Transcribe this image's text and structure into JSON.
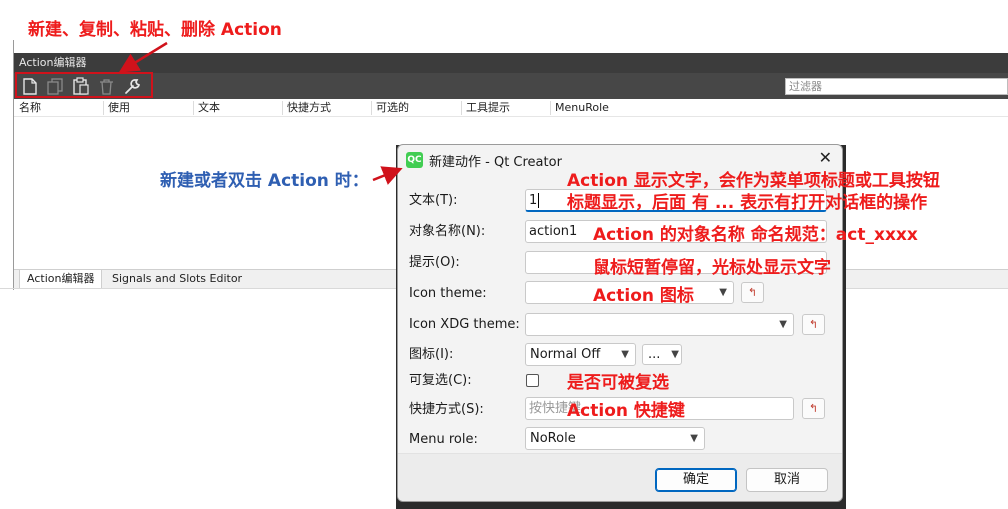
{
  "annotations": {
    "toolbar_note": "新建、复制、粘贴、删除 Action",
    "new_action_note": "新建或者双击 Action 时：",
    "text_note_line1": "Action 显示文字，会作为菜单项标题或工具按钮",
    "text_note_line2": "标题显示，后面 有 ... 表示有打开对话框的操作",
    "object_name_note": "Action 的对象名称 命名规范：act_xxxx",
    "tooltip_note": "鼠标短暂停留，光标处显示文字",
    "icon_theme_note": "Action 图标",
    "checkable_note": "是否可被复选",
    "shortcut_note": "Action 快捷键"
  },
  "editor": {
    "title": "Action编辑器",
    "filter_placeholder": "过滤器",
    "toolbar_icons": [
      "new-file-icon",
      "copy-icon",
      "paste-icon",
      "delete-icon",
      "wrench-icon"
    ],
    "columns": [
      "名称",
      "使用",
      "文本",
      "快捷方式",
      "可选的",
      "工具提示",
      "MenuRole"
    ],
    "tabs": [
      "Action编辑器",
      "Signals and Slots Editor"
    ]
  },
  "dialog": {
    "logo": "QC",
    "title": "新建动作 - Qt Creator",
    "close_glyph": "✕",
    "labels": {
      "text": "文本(T):",
      "object_name": "对象名称(N):",
      "tooltip": "提示(O):",
      "icon_theme": "Icon theme:",
      "icon_xdg_theme": "Icon XDG theme:",
      "icon": "图标(I):",
      "checkable": "可复选(C):",
      "shortcut": "快捷方式(S):",
      "menu_role": "Menu role:"
    },
    "values": {
      "text": "1",
      "object_name": "action1",
      "tooltip": "",
      "icon_theme": "",
      "icon_xdg_theme": "",
      "icon_mode": "Normal Off",
      "icon_browse": "...",
      "shortcut_placeholder": "按快捷键",
      "menu_role": "NoRole"
    },
    "reset_glyph": "↰",
    "buttons": {
      "ok": "确定",
      "cancel": "取消"
    }
  },
  "colors": {
    "annotation_red": "#ee1c1c",
    "annotation_blue": "#2f5fb2",
    "focus_blue": "#0067c0"
  }
}
